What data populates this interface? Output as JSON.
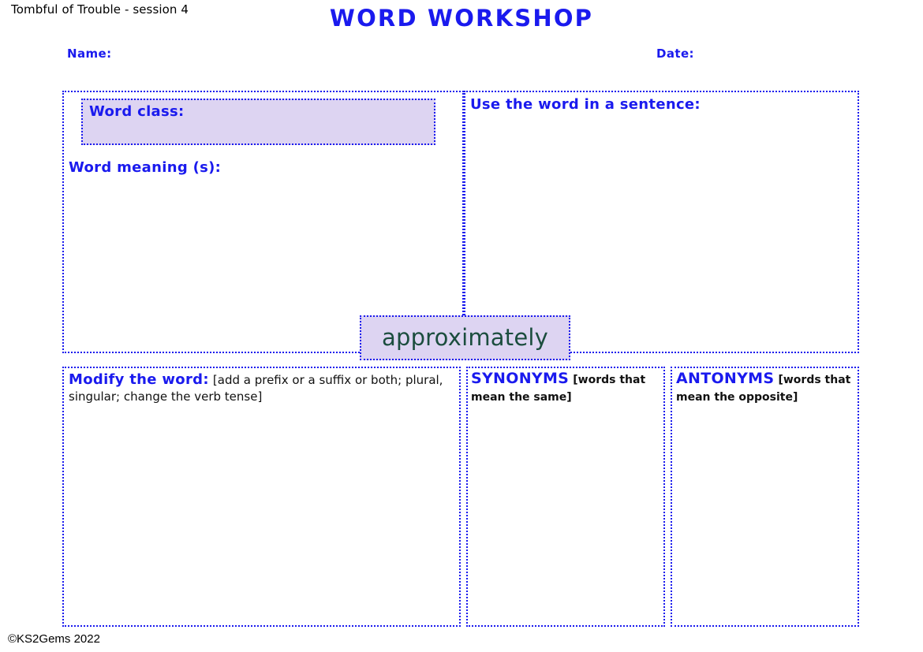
{
  "header": {
    "session_label": "Tombful of Trouble - session 4",
    "title": "WORD WORKSHOP",
    "name_label": "Name:",
    "date_label": "Date:"
  },
  "focus_word": "approximately",
  "panels": {
    "word_class": {
      "label": "Word class:"
    },
    "word_meaning": {
      "label": "Word meaning (s):"
    },
    "sentence": {
      "label": "Use the word in a sentence:"
    },
    "modify": {
      "label": "Modify the word:",
      "note": "[add a prefix or a suffix or both; plural, singular; change the verb tense]"
    },
    "synonyms": {
      "label": "SYNONYMS",
      "note": "[words that mean the same]"
    },
    "antonyms": {
      "label": "ANTONYMS",
      "note": "[words that mean the opposite]"
    }
  },
  "footer": {
    "copyright": "©KS2Gems 2022"
  },
  "colors": {
    "accent_blue": "#1a1aee",
    "fill_lavender": "#ddd4f2",
    "focus_word_green": "#1b4d3e",
    "text_black": "#000000"
  }
}
